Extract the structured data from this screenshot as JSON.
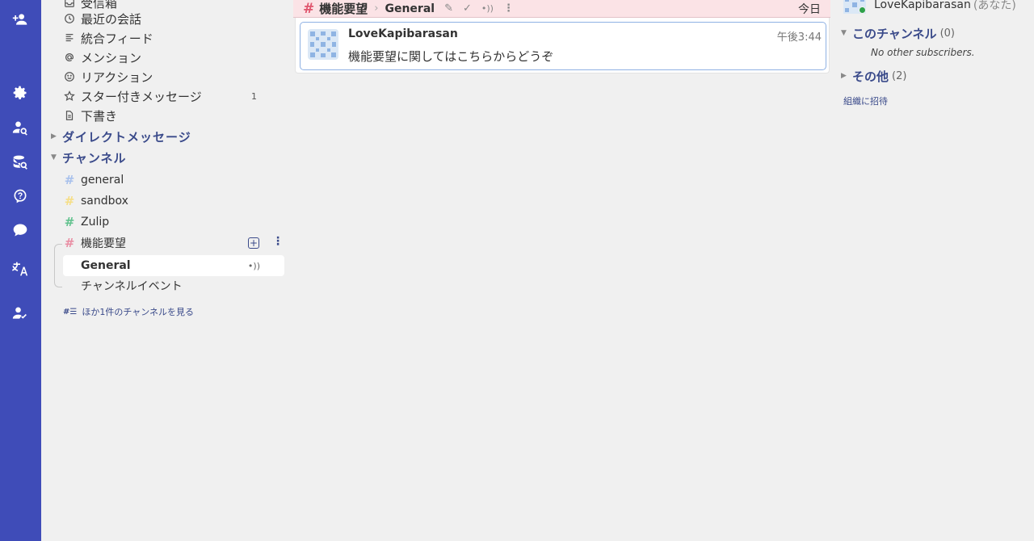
{
  "rail": {
    "icons": [
      "add-user-icon",
      "gear-icon",
      "user-search-icon",
      "database-search-icon",
      "help-icon",
      "chat-bubble-icon",
      "translate-icon",
      "user-check-icon"
    ]
  },
  "sidebar": {
    "nav": [
      {
        "label": "受信箱",
        "icon": "inbox-icon"
      },
      {
        "label": "最近の会話",
        "icon": "clock-icon"
      },
      {
        "label": "統合フィード",
        "icon": "feed-icon"
      },
      {
        "label": "メンション",
        "icon": "at-icon"
      },
      {
        "label": "リアクション",
        "icon": "smile-icon"
      },
      {
        "label": "スター付きメッセージ",
        "icon": "star-icon",
        "count": "1"
      },
      {
        "label": "下書き",
        "icon": "draft-icon"
      }
    ],
    "dm_header": "ダイレクトメッセージ",
    "channels_header": "チャンネル",
    "channels": [
      {
        "name": "general",
        "color": "#a8c1ec"
      },
      {
        "name": "sandbox",
        "color": "#f6de86"
      },
      {
        "name": "Zulip",
        "color": "#62c28e"
      },
      {
        "name": "機能要望",
        "color": "#e98fa4"
      }
    ],
    "topics": [
      {
        "name": "General",
        "active": true
      },
      {
        "name": "チャンネルイベント",
        "active": false
      }
    ],
    "more_channels": "ほか1件のチャンネルを見る"
  },
  "header": {
    "stream": "機能要望",
    "topic": "General",
    "date": "今日",
    "accent": "#e0566e"
  },
  "message": {
    "sender": "LoveKapibarasan",
    "time": "午後3:44",
    "content": "機能要望に関してはこちらからどうぞ"
  },
  "right": {
    "me_name": "LoveKapibarasan",
    "me_suffix": "(あなた)",
    "this_channel_label": "このチャンネル",
    "this_channel_count": "(0)",
    "no_subs": "No other subscribers.",
    "others_label": "その他",
    "others_count": "(2)",
    "invite": "組織に招待"
  }
}
